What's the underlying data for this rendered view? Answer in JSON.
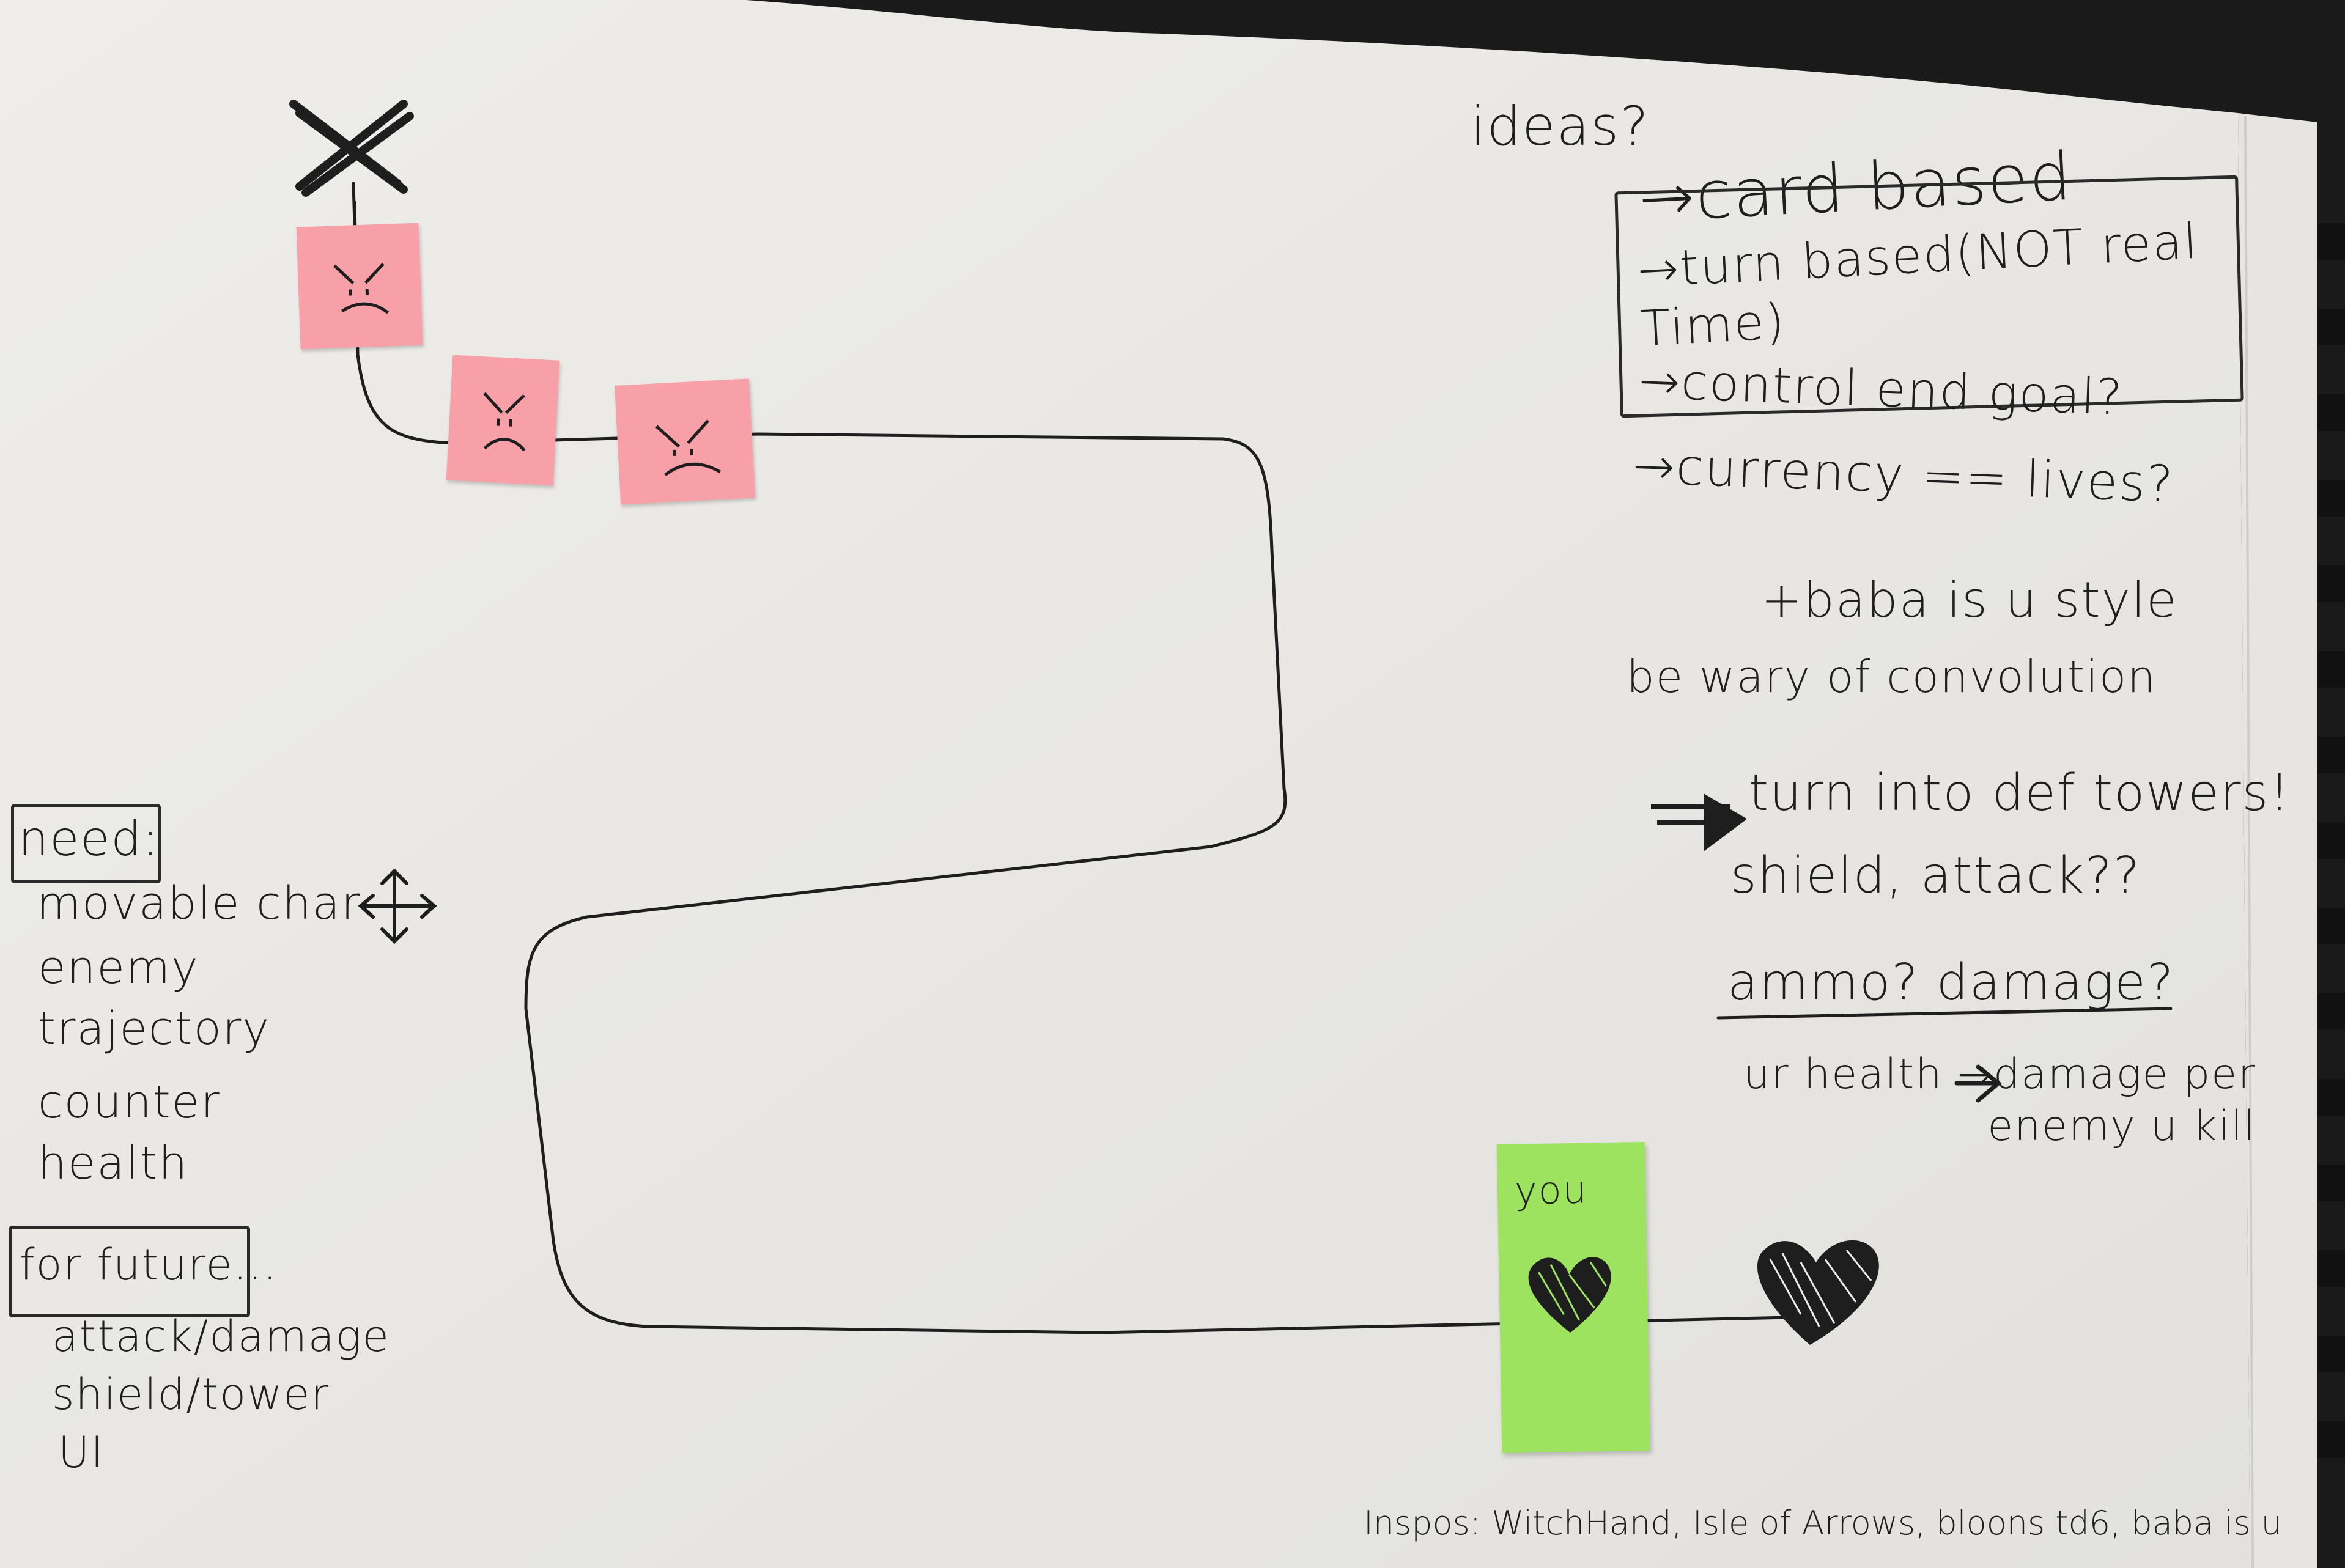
{
  "notes": {
    "ideas_heading": "ideas?",
    "ideas": [
      "→card based",
      "→turn based(NOT real Time)",
      "→control end goal?",
      "→currency == lives?",
      "+baba is u style",
      "be wary of convolution",
      "turn into def towers!",
      "shield, attack??",
      "ammo? damage?",
      "ur health →damage per enemy u kill"
    ]
  },
  "need": {
    "heading": "need:",
    "items": [
      "movable char",
      "enemy",
      "trajectory",
      "counter",
      "health"
    ]
  },
  "future": {
    "heading": "for future...",
    "items": [
      "attack/damage",
      "shield/tower",
      "UI"
    ]
  },
  "player": {
    "label": "you"
  },
  "inspo": "Inspos: WitchHand, Isle of Arrows, bloons td6, baba is u",
  "colors": {
    "paper": "#ecebe8",
    "ink": "#1e1e1e",
    "enemy_sticky": "#f7a0a8",
    "player_sticky": "#9ee35f",
    "background": "#1a1a1a"
  },
  "icons": [
    "x-goal-icon",
    "move-arrows-icon",
    "heart-icon",
    "angry-face-icon"
  ]
}
